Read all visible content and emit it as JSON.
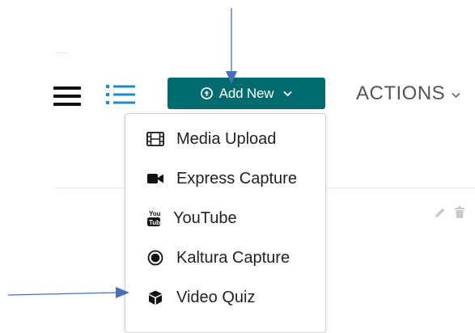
{
  "toolbar": {
    "add_new_label": "Add New",
    "actions_label": "ACTIONS"
  },
  "menu": {
    "items": [
      {
        "label": "Media Upload",
        "icon": "film-icon"
      },
      {
        "label": "Express Capture",
        "icon": "video-camera-icon"
      },
      {
        "label": "YouTube",
        "icon": "youtube-icon"
      },
      {
        "label": "Kaltura Capture",
        "icon": "record-icon"
      },
      {
        "label": "Video Quiz",
        "icon": "cube-icon"
      }
    ]
  },
  "colors": {
    "accent": "#006b6f",
    "annotation_arrow": "#4a6fb5",
    "menu_text": "#222222"
  }
}
